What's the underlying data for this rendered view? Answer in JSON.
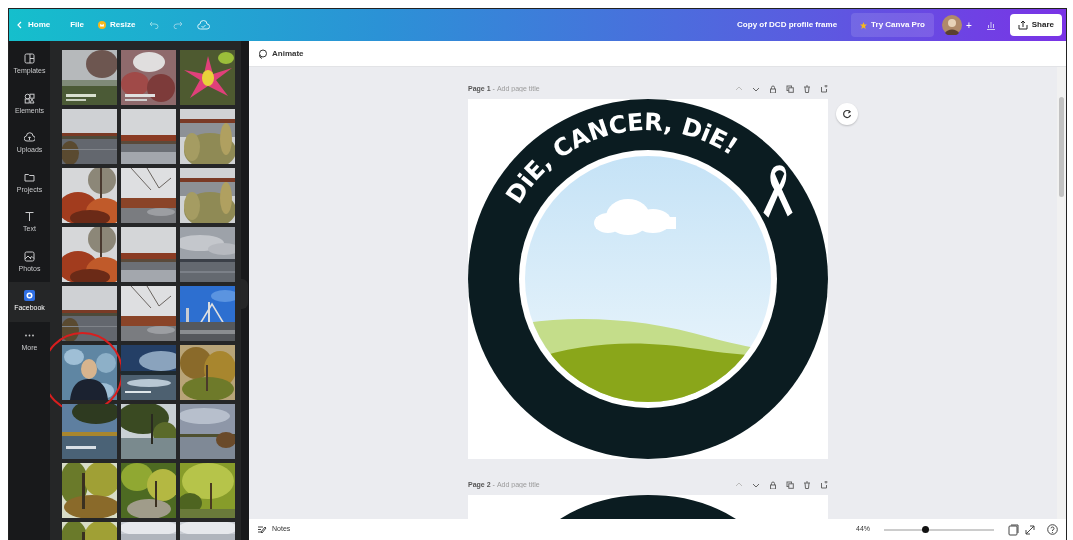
{
  "topbar": {
    "home": "Home",
    "file": "File",
    "resize": "Resize",
    "title": "Copy of DCD profile frame",
    "try_pro": "Try Canva Pro",
    "add": "+",
    "share": "Share"
  },
  "sidebar": {
    "items": [
      {
        "label": "Templates",
        "selected": false
      },
      {
        "label": "Elements",
        "selected": false
      },
      {
        "label": "Uploads",
        "selected": false
      },
      {
        "label": "Projects",
        "selected": false
      },
      {
        "label": "Text",
        "selected": false
      },
      {
        "label": "Photos",
        "selected": false
      },
      {
        "label": "Facebook",
        "selected": true
      },
      {
        "label": "More",
        "selected": false
      }
    ]
  },
  "photos": [
    {
      "kind": "picture",
      "circled": false
    },
    {
      "kind": "picture",
      "circled": false
    },
    {
      "kind": "picture",
      "circled": false
    },
    {
      "kind": "picture",
      "circled": false
    },
    {
      "kind": "picture",
      "circled": false
    },
    {
      "kind": "picture",
      "circled": false
    },
    {
      "kind": "picture",
      "circled": false
    },
    {
      "kind": "picture",
      "circled": false
    },
    {
      "kind": "picture",
      "circled": false
    },
    {
      "kind": "picture",
      "circled": false
    },
    {
      "kind": "picture",
      "circled": false
    },
    {
      "kind": "picture",
      "circled": false
    },
    {
      "kind": "picture",
      "circled": false
    },
    {
      "kind": "picture",
      "circled": false
    },
    {
      "kind": "picture",
      "circled": false
    },
    {
      "kind": "picture",
      "circled": true
    },
    {
      "kind": "picture",
      "circled": false
    },
    {
      "kind": "picture",
      "circled": false
    },
    {
      "kind": "picture",
      "circled": false
    },
    {
      "kind": "picture",
      "circled": false
    },
    {
      "kind": "picture",
      "circled": false
    },
    {
      "kind": "picture",
      "circled": false
    },
    {
      "kind": "picture",
      "circled": false
    },
    {
      "kind": "picture",
      "circled": false
    },
    {
      "kind": "picture",
      "circled": false
    },
    {
      "kind": "picture",
      "circled": false
    },
    {
      "kind": "picture",
      "circled": false
    }
  ],
  "toolbar": {
    "animate": "Animate"
  },
  "pages": [
    {
      "label": "Page 1",
      "separator": "-",
      "placeholder": "Add page title",
      "design": {
        "arc_text": "DiE, CANCER, DiE!"
      }
    },
    {
      "label": "Page 2",
      "separator": "-",
      "placeholder": "Add page title"
    }
  ],
  "footer": {
    "notes": "Notes",
    "zoom": "44%",
    "zoom_slider": {
      "level": 0.37
    }
  }
}
